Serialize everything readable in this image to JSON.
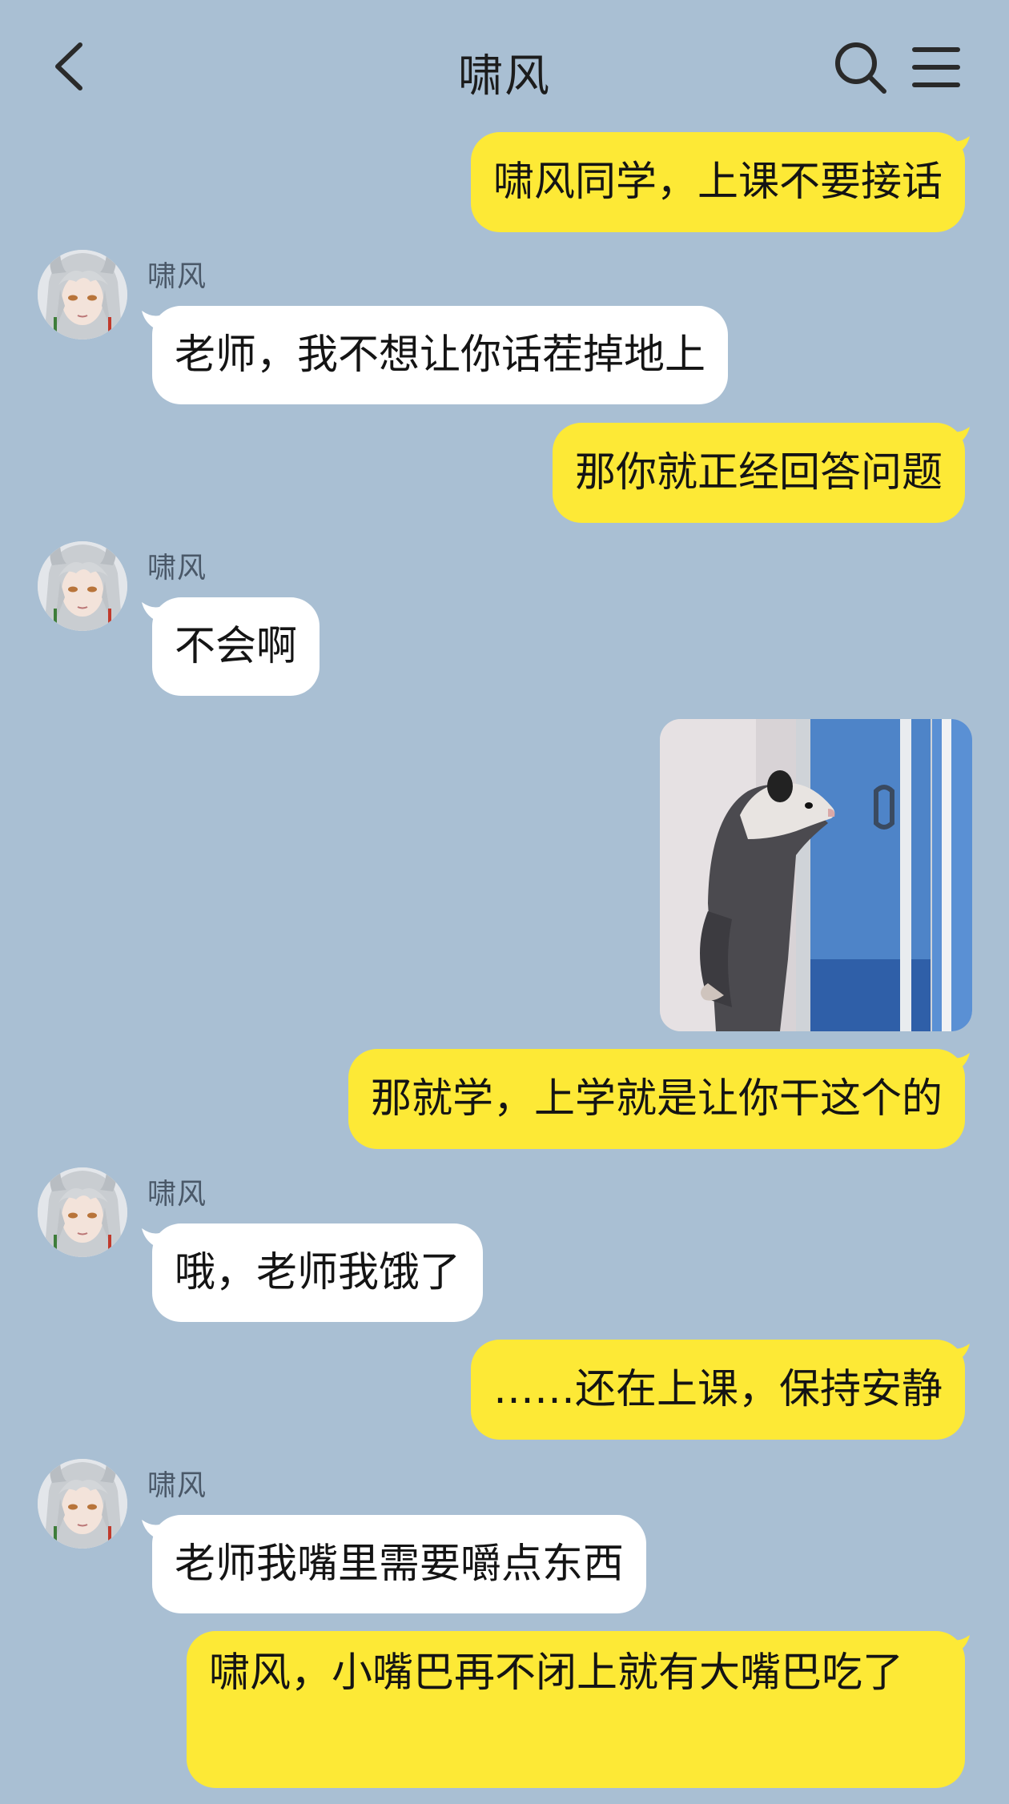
{
  "header": {
    "title": "啸风"
  },
  "icons": {
    "back": "chevron-left-icon",
    "search": "search-icon",
    "menu": "menu-icon"
  },
  "colors": {
    "background": "#a9bfd3",
    "outgoing_bubble": "#fde936",
    "incoming_bubble": "#ffffff"
  },
  "messages": [
    {
      "direction": "outgoing",
      "text": "啸风同学，上课不要接话"
    },
    {
      "direction": "incoming",
      "sender": "啸风",
      "text": "老师，我不想让你话茬掉地上"
    },
    {
      "direction": "outgoing",
      "text": "那你就正经回答问题"
    },
    {
      "direction": "incoming",
      "sender": "啸风",
      "text": "不会啊"
    },
    {
      "direction": "outgoing",
      "type": "image",
      "image": "opossum-standing-at-window-image"
    },
    {
      "direction": "outgoing",
      "text": "那就学，上学就是让你干这个的"
    },
    {
      "direction": "incoming",
      "sender": "啸风",
      "text": "哦，老师我饿了"
    },
    {
      "direction": "outgoing",
      "text": "……还在上课，保持安静"
    },
    {
      "direction": "incoming",
      "sender": "啸风",
      "text": "老师我嘴里需要嚼点东西"
    },
    {
      "direction": "outgoing",
      "text": "啸风，小嘴巴再不闭上就有大嘴巴吃了"
    }
  ]
}
